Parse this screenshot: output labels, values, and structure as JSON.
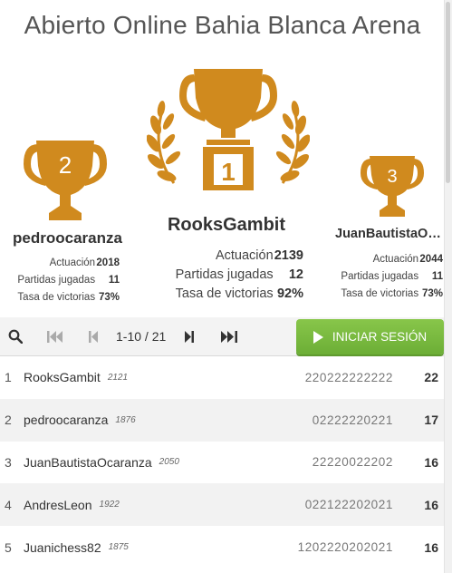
{
  "tournament": {
    "title": "Abierto Online Bahia Blanca Arena"
  },
  "podium": {
    "first": {
      "place": "1",
      "name": "RooksGambit",
      "stats": [
        {
          "label": "Actuación",
          "value": "2139"
        },
        {
          "label": "Partidas jugadas",
          "value": "12"
        },
        {
          "label": "Tasa de victorias",
          "value": "92%"
        }
      ]
    },
    "second": {
      "place": "2",
      "name": "pedroocaranza",
      "stats": [
        {
          "label": "Actuación",
          "value": "2018"
        },
        {
          "label": "Partidas jugadas",
          "value": "11"
        },
        {
          "label": "Tasa de victorias",
          "value": "73%"
        }
      ]
    },
    "third": {
      "place": "3",
      "name": "JuanBautistaOcaranza",
      "stats": [
        {
          "label": "Actuación",
          "value": "2044"
        },
        {
          "label": "Partidas jugadas",
          "value": "11"
        },
        {
          "label": "Tasa de victorias",
          "value": "73%"
        }
      ]
    }
  },
  "controls": {
    "search_icon": "search-icon",
    "first_page_icon": "first-page-icon",
    "prev_page_icon": "prev-page-icon",
    "next_page_icon": "next-page-icon",
    "last_page_icon": "last-page-icon",
    "page_info": "1-10 / 21",
    "sign_in_label": "INICIAR SESIÓN"
  },
  "standings": [
    {
      "rank": "1",
      "name": "RooksGambit",
      "rating": "2121",
      "sheet": "220222222222",
      "score": "22"
    },
    {
      "rank": "2",
      "name": "pedroocaranza",
      "rating": "1876",
      "sheet": "02222220221",
      "score": "17"
    },
    {
      "rank": "3",
      "name": "JuanBautistaOcaranza",
      "rating": "2050",
      "sheet": "22220022202",
      "score": "16"
    },
    {
      "rank": "4",
      "name": "AndresLeon",
      "rating": "1922",
      "sheet": "022122202021",
      "score": "16"
    },
    {
      "rank": "5",
      "name": "Juanichess82",
      "rating": "1875",
      "sheet": "1202220202021",
      "score": "16"
    }
  ],
  "colors": {
    "trophy": "#d08a1e",
    "accent_green": "#7cba40",
    "stripe": "#f2f2f2"
  }
}
